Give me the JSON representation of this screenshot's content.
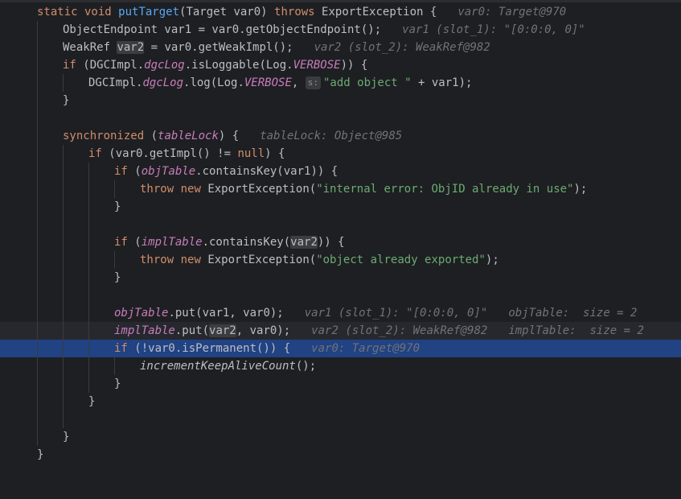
{
  "editor": {
    "lines": [
      {
        "k": "sig",
        "t1": "static void ",
        "fn": "putTarget",
        "t2": "(Target var0) ",
        "kw2": "throws",
        "t3": " ExportException {",
        "hint": "var0: Target@970"
      },
      {
        "k": "plain",
        "pre": "ObjectEndpoint var1 = var0.getObjectEndpoint();",
        "hint": "var1 (slot_1): \"[0:0:0, 0]\""
      },
      {
        "k": "weak",
        "a": "WeakRef ",
        "v": "var2",
        "b": " = var0.getWeakImpl();",
        "hint": "var2 (slot_2): WeakRef@982"
      },
      {
        "k": "if1",
        "kw": "if",
        "a": " (DGCImpl.",
        "f": "dgcLog",
        "b": ".isLoggable(Log.",
        "sf": "VERBOSE",
        "c": ")) {"
      },
      {
        "k": "log",
        "a": "DGCImpl.",
        "f": "dgcLog",
        "b": ".log(Log.",
        "sf": "VERBOSE",
        "c": ", ",
        "param": "s:",
        "str": "\"add object \"",
        "d": " + var1);"
      },
      {
        "k": "close",
        "t": "}"
      },
      {
        "k": "blank"
      },
      {
        "k": "sync",
        "kw": "synchronized",
        "a": " (",
        "f": "tableLock",
        "b": ") {",
        "hint": "tableLock: Object@985"
      },
      {
        "k": "if2",
        "kw": "if",
        "a": " (var0.getImpl() != ",
        "kw2": "null",
        "b": ") {"
      },
      {
        "k": "if3",
        "kw": "if",
        "a": " (",
        "f": "objTable",
        "b": ".containsKey(var1)) {"
      },
      {
        "k": "throw1",
        "kw": "throw",
        "kw2": "new",
        "a": " ExportException(",
        "str": "\"internal error: ObjID already in use\"",
        "b": ");"
      },
      {
        "k": "close",
        "t": "}"
      },
      {
        "k": "blank"
      },
      {
        "k": "if4",
        "kw": "if",
        "a": " (",
        "f": "implTable",
        "b": ".containsKey(",
        "v": "var2",
        "c": ")) {"
      },
      {
        "k": "throw2",
        "kw": "throw",
        "kw2": "new",
        "a": " ExportException(",
        "str": "\"object already exported\"",
        "b": ");"
      },
      {
        "k": "close",
        "t": "}"
      },
      {
        "k": "blank"
      },
      {
        "k": "put1",
        "f": "objTable",
        "a": ".put(var1, var0);",
        "hint": "var1 (slot_1): \"[0:0:0, 0]\"",
        "hint2": "objTable:  size = 2"
      },
      {
        "k": "put2",
        "f": "implTable",
        "a": ".put(",
        "v": "var2",
        "b": ", var0);",
        "hint": "var2 (slot_2): WeakRef@982",
        "hint2": "implTable:  size = 2"
      },
      {
        "k": "exec",
        "kw": "if",
        "a": " (!var0.isPermanent()) {",
        "hint": "var0: Target@970"
      },
      {
        "k": "call",
        "f": "incrementKeepAliveCount",
        "a": "();"
      },
      {
        "k": "close",
        "t": "}"
      },
      {
        "k": "close",
        "t": "}"
      },
      {
        "k": "blank"
      },
      {
        "k": "close",
        "t": "}"
      },
      {
        "k": "close",
        "t": "}"
      }
    ]
  }
}
